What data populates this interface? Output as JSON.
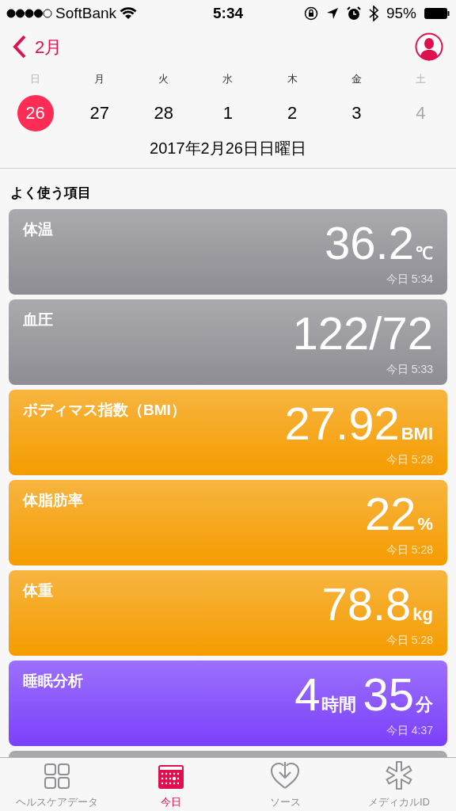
{
  "status_bar": {
    "carrier": "SoftBank",
    "time": "5:34",
    "battery": "95%"
  },
  "nav": {
    "back_label": "2月"
  },
  "week": [
    {
      "weekday": "日",
      "date": "26",
      "selected": true,
      "weekend": true
    },
    {
      "weekday": "月",
      "date": "27",
      "selected": false,
      "weekend": false
    },
    {
      "weekday": "火",
      "date": "28",
      "selected": false,
      "weekend": false
    },
    {
      "weekday": "水",
      "date": "1",
      "selected": false,
      "weekend": false
    },
    {
      "weekday": "木",
      "date": "2",
      "selected": false,
      "weekend": false
    },
    {
      "weekday": "金",
      "date": "3",
      "selected": false,
      "weekend": false
    },
    {
      "weekday": "土",
      "date": "4",
      "selected": false,
      "weekend": true
    }
  ],
  "date_title": "2017年2月26日日曜日",
  "section_title": "よく使う項目",
  "cards": [
    {
      "title": "体温",
      "color": "#8e8d93",
      "value": [
        {
          "text": "36.2",
          "kind": "number"
        },
        {
          "text": "℃",
          "kind": "unit"
        }
      ],
      "time": "今日 5:34"
    },
    {
      "title": "血圧",
      "color": "#8e8d93",
      "value": [
        {
          "text": "122/72",
          "kind": "number"
        }
      ],
      "time": "今日 5:33"
    },
    {
      "title": "ボディマス指数（BMI）",
      "color": "#f59c00",
      "value": [
        {
          "text": "27.92",
          "kind": "number"
        },
        {
          "text": "BMI",
          "kind": "unit"
        }
      ],
      "time": "今日 5:28"
    },
    {
      "title": "体脂肪率",
      "color": "#f59c00",
      "value": [
        {
          "text": "22",
          "kind": "number"
        },
        {
          "text": "%",
          "kind": "unit"
        }
      ],
      "time": "今日 5:28"
    },
    {
      "title": "体重",
      "color": "#f59c00",
      "value": [
        {
          "text": "78.8",
          "kind": "number"
        },
        {
          "text": "kg",
          "kind": "unit"
        }
      ],
      "time": "今日 5:28"
    },
    {
      "title": "睡眠分析",
      "color": "#7b40fb",
      "value": [
        {
          "text": "4",
          "kind": "number"
        },
        {
          "text": "時間",
          "kind": "unit"
        },
        {
          "text": "35",
          "kind": "number"
        },
        {
          "text": "分",
          "kind": "unit"
        }
      ],
      "time": "今日 4:37"
    }
  ],
  "tabs": [
    {
      "label": "ヘルスケアデータ",
      "selected": false
    },
    {
      "label": "今日",
      "selected": true
    },
    {
      "label": "ソース",
      "selected": false
    },
    {
      "label": "メディカルID",
      "selected": false
    }
  ]
}
